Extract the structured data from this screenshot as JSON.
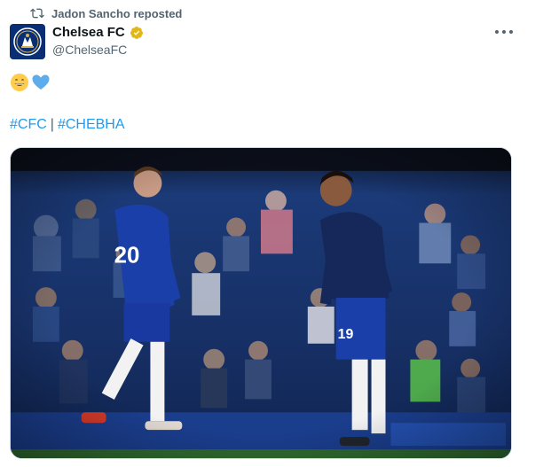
{
  "repost": {
    "text": "Jadon Sancho reposted",
    "icon": "repost-icon"
  },
  "author": {
    "display_name": "Chelsea FC",
    "handle": "@ChelseaFC",
    "verified_color": "#e2b719",
    "avatar_icon": "chelsea-crest-icon",
    "avatar_color": "#0a2e73"
  },
  "post": {
    "emojis": [
      "grinning-face-emoji",
      "blue-heart-emoji"
    ],
    "hashtags": [
      "#CFC",
      "#CHEBHA"
    ],
    "hashtag_separator": "|",
    "link_color": "#1d9bf0"
  },
  "media": {
    "description_icon": "players-photo",
    "player_left_number": "20",
    "player_right_number": "19"
  },
  "menu": {
    "icon": "more-options-icon"
  }
}
